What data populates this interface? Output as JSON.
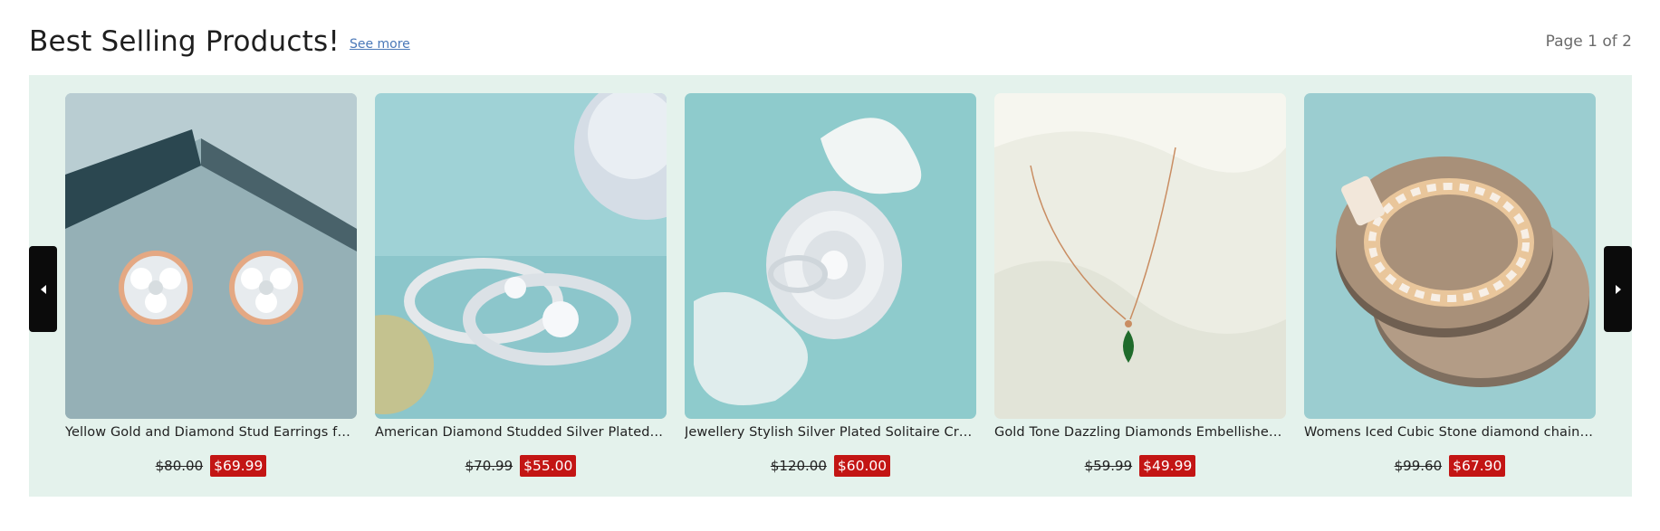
{
  "section": {
    "title": "Best Selling Products!",
    "see_more": "See more",
    "page_info": "Page 1 of 2"
  },
  "carousel": {
    "background_color": "#e4f2ec",
    "prev_icon": "caret-left-icon",
    "next_icon": "caret-right-icon",
    "products": [
      {
        "name": "Yellow Gold and Diamond Stud Earrings for Women",
        "old_price": "$80.00",
        "new_price": "$69.99",
        "image": "stud-earrings-image"
      },
      {
        "name": "American Diamond Studded Silver Plated Finger Ring Set",
        "old_price": "$70.99",
        "new_price": "$55.00",
        "image": "silver-ring-set-image"
      },
      {
        "name": "Jewellery Stylish Silver Plated Solitaire Crystal Ring",
        "old_price": "$120.00",
        "new_price": "$60.00",
        "image": "crystal-cluster-ring-image"
      },
      {
        "name": "Gold Tone Dazzling Diamonds Embellished Pendant Necklace",
        "old_price": "$59.99",
        "new_price": "$49.99",
        "image": "emerald-pendant-necklace-image"
      },
      {
        "name": "Womens Iced Cubic Stone diamond chain Bracelet",
        "old_price": "$99.60",
        "new_price": "$67.90",
        "image": "iced-chain-bracelet-image"
      }
    ]
  },
  "colors": {
    "sale_badge": "#c31514",
    "nav_button": "#0b0b0b",
    "link": "#4a78b8"
  }
}
